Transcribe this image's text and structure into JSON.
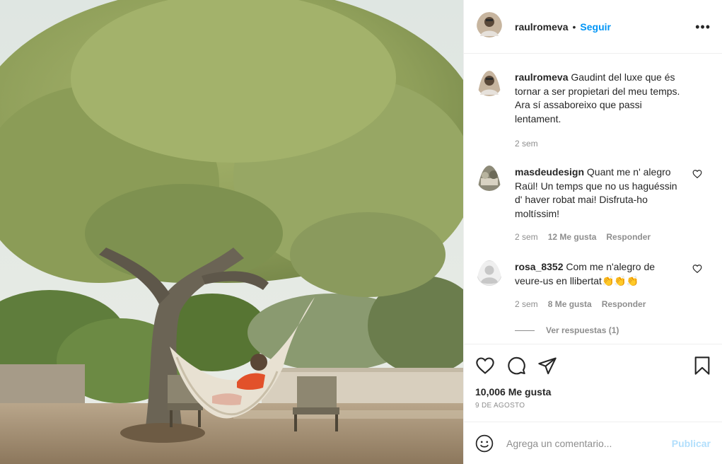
{
  "post": {
    "photo_alt": "",
    "author": "raulromeva",
    "separator": "•",
    "follow_label": "Seguir",
    "more_label": "•••"
  },
  "caption": {
    "user": "raulromeva",
    "text": "Gaudint del luxe que és tornar a ser propietari del meu temps. Ara sí assaboreixo que passi lentament.",
    "time": "2 sem"
  },
  "comments": [
    {
      "user": "masdeudesign",
      "text": "Quant me n' alegro Raül! Un temps que no us haguéssin d' haver robat mai! Disfruta-ho moltíssim!",
      "time": "2 sem",
      "likes": "12 Me gusta",
      "reply_label": "Responder"
    },
    {
      "user": "rosa_8352",
      "text": "Com me n'alegro de veure-us en llibertat",
      "emoji": "👏👏👏",
      "time": "2 sem",
      "likes": "8 Me gusta",
      "reply_label": "Responder"
    }
  ],
  "view_replies": "Ver respuestas (1)",
  "actions": {
    "like_icon": "heart-icon",
    "comment_icon": "comment-icon",
    "share_icon": "share-icon",
    "save_icon": "bookmark-icon"
  },
  "likes_count": "10,006 Me gusta",
  "post_date": "9 DE AGOSTO",
  "add_comment": {
    "placeholder": "Agrega un comentario...",
    "post_label": "Publicar"
  },
  "colors": {
    "link_blue": "#0095f6",
    "publish_disabled": "#b2dffc",
    "muted": "#8e8e8e",
    "text": "#262626"
  }
}
